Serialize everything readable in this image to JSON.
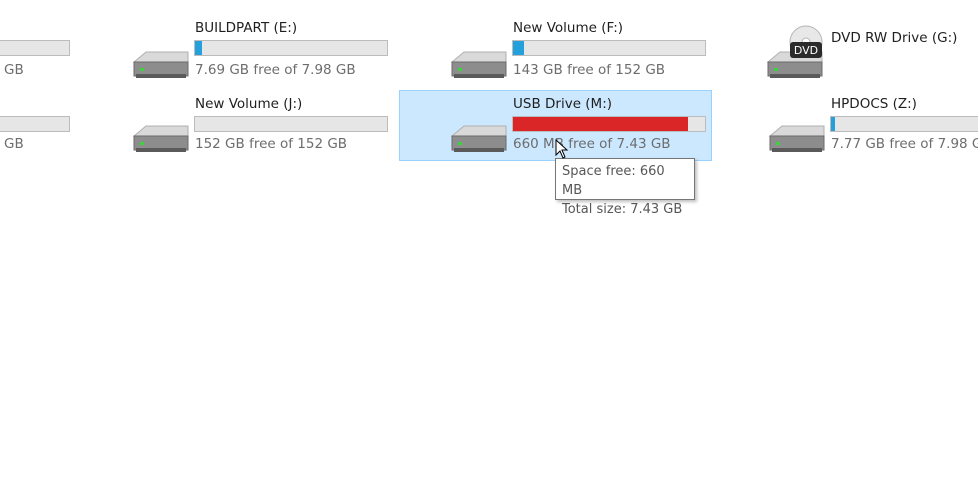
{
  "colors": {
    "bar_normal": "#26a0da",
    "bar_full": "#da2626",
    "selection": "#cce8ff"
  },
  "drives": [
    {
      "id": "partial-1",
      "name": "",
      "free_text": "GB",
      "used_fraction": 0.0,
      "icon": "drive-icon"
    },
    {
      "id": "e",
      "name": "BUILDPART (E:)",
      "free_text": "7.69 GB free of 7.98 GB",
      "used_fraction": 0.036,
      "icon": "drive-icon"
    },
    {
      "id": "f",
      "name": "New Volume (F:)",
      "free_text": "143 GB free of 152 GB",
      "used_fraction": 0.059,
      "icon": "drive-icon"
    },
    {
      "id": "g",
      "name": "DVD RW Drive (G:)",
      "free_text": "",
      "used_fraction": null,
      "icon": "dvd-drive-icon"
    },
    {
      "id": "partial-2",
      "name": "",
      "free_text": "GB",
      "used_fraction": 0.0,
      "icon": "drive-icon"
    },
    {
      "id": "j",
      "name": "New Volume (J:)",
      "free_text": "152 GB free of 152 GB",
      "used_fraction": 0.0,
      "icon": "drive-icon"
    },
    {
      "id": "m",
      "name": "USB Drive (M:)",
      "free_text": "660 MB free of 7.43 GB",
      "used_fraction": 0.913,
      "icon": "drive-icon",
      "selected": true
    },
    {
      "id": "z",
      "name": "HPDOCS (Z:)",
      "free_text": "7.77 GB free of 7.98 GB",
      "used_fraction": 0.026,
      "icon": "drive-icon"
    }
  ],
  "tooltip": {
    "space_free": "Space free: 660 MB",
    "total_size": "Total size: 7.43 GB"
  },
  "dvd_label": "DVD"
}
